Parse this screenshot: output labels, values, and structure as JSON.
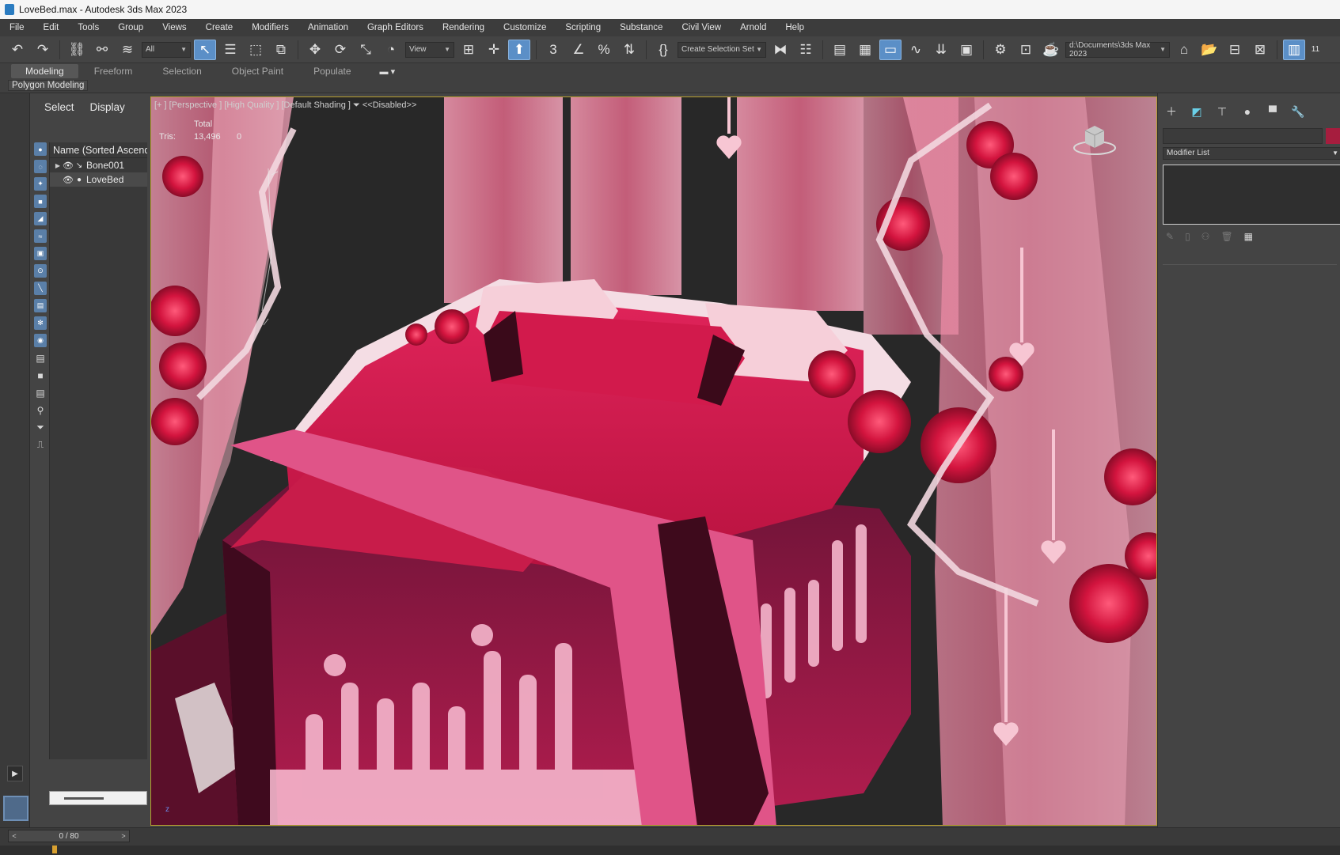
{
  "window": {
    "title": "LoveBed.max - Autodesk 3ds Max 2023"
  },
  "menu": [
    "File",
    "Edit",
    "Tools",
    "Group",
    "Views",
    "Create",
    "Modifiers",
    "Animation",
    "Graph Editors",
    "Rendering",
    "Customize",
    "Scripting",
    "Substance",
    "Civil View",
    "Arnold",
    "Help"
  ],
  "toolbar": {
    "filter_value": "All",
    "refcoord_value": "View",
    "selection_set_placeholder": "Create Selection Set",
    "project_path": "d:\\Documents\\3ds Max 2023",
    "right_number": "11"
  },
  "ribbon": {
    "tabs": [
      "Modeling",
      "Freeform",
      "Selection",
      "Object Paint",
      "Populate"
    ],
    "active_tab": "Modeling",
    "sub_label": "Polygon Modeling"
  },
  "explorer": {
    "tabs": [
      "Select",
      "Display"
    ],
    "header": "Name (Sorted Ascending)",
    "rows": [
      {
        "name": "Bone001",
        "selected": false
      },
      {
        "name": "LoveBed",
        "selected": true
      }
    ]
  },
  "viewport": {
    "label": "[+ ] [Perspective ] [High Quality ] [Default Shading ]",
    "filter_label": "<<Disabled>>",
    "stats_header": "Total",
    "stats_key": "Tris:",
    "stats_total": "13,496",
    "stats_selected": "0",
    "axis_label": "z"
  },
  "command_panel": {
    "modifier_list_label": "Modifier List",
    "object_color": "#a61d3e"
  },
  "timeline": {
    "frame_display": "0 / 80",
    "current_frame": 0,
    "total_frames": 80
  },
  "colors": {
    "accent": "#5b8fc7",
    "viewport_border": "#b8a030",
    "bed_primary": "#d81b4f",
    "bed_dark": "#5a0f2a",
    "canopy_pink": "#f07a98"
  }
}
